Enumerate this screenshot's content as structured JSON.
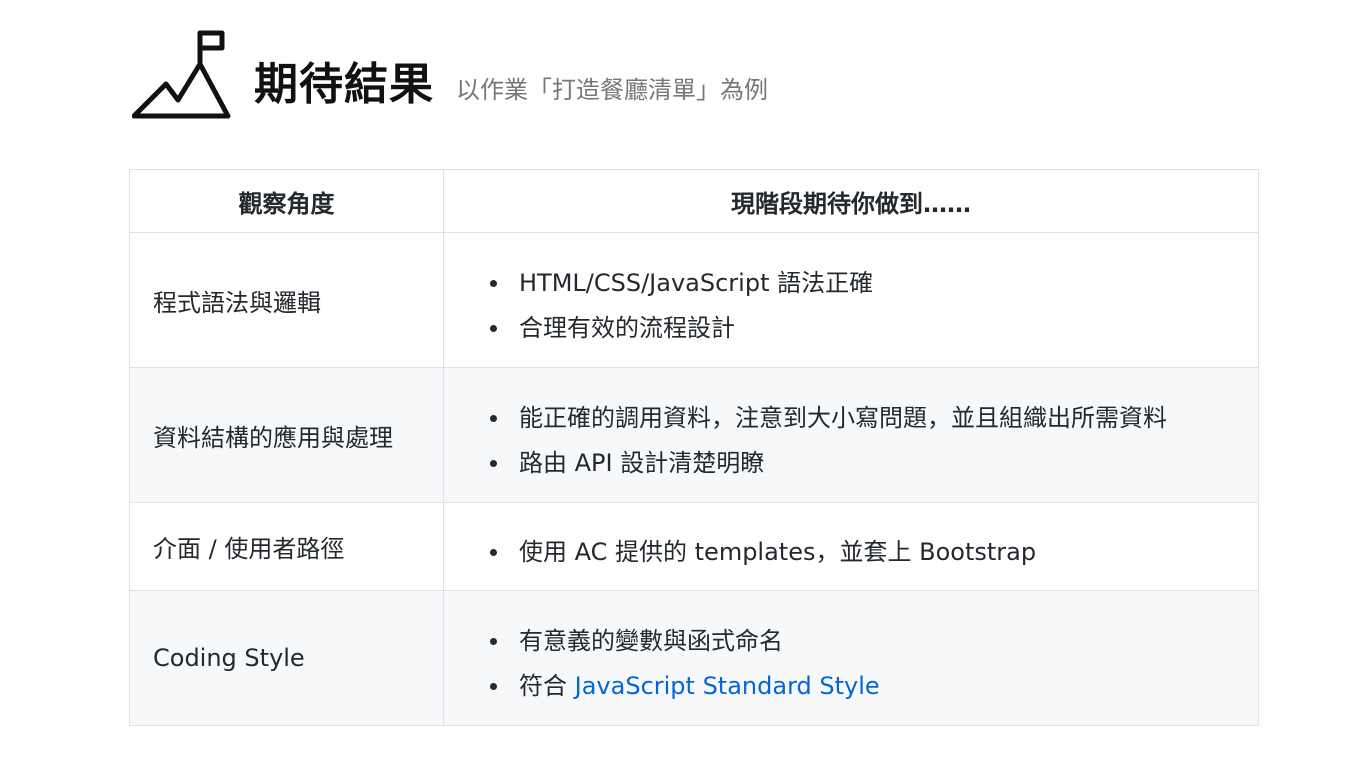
{
  "header": {
    "icon": "mountain-flag-icon",
    "title": "期待結果",
    "subtitle": "以作業「打造餐廳清單」為例"
  },
  "table": {
    "columns": [
      "觀察角度",
      "現階段期待你做到……"
    ],
    "rows": [
      {
        "aspect": "程式語法與邏輯",
        "items": [
          "HTML/CSS/JavaScript 語法正確",
          "合理有效的流程設計"
        ]
      },
      {
        "aspect": "資料結構的應用與處理",
        "items": [
          "能正確的調用資料，注意到大小寫問題，並且組織出所需資料",
          "路由 API 設計清楚明瞭"
        ]
      },
      {
        "aspect": "介面 / 使用者路徑",
        "items": [
          "使用 AC 提供的 templates，並套上 Bootstrap"
        ]
      },
      {
        "aspect": "Coding Style",
        "items": [
          "有意義的變數與函式命名"
        ],
        "link_item": {
          "prefix": "符合 ",
          "link_text": "JavaScript Standard Style"
        }
      }
    ]
  },
  "colors": {
    "link": "#0366d6",
    "border": "#dfe2e5",
    "stripe": "#f6f8fa"
  }
}
